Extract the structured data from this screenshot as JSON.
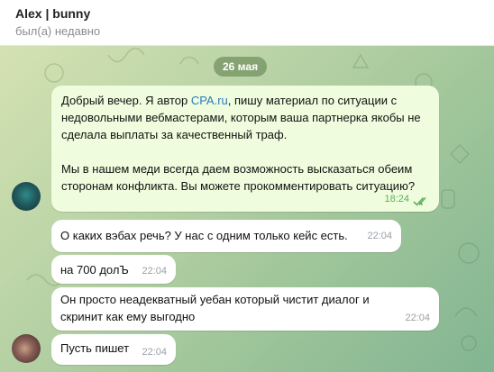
{
  "header": {
    "title": "Alex | bunny",
    "status": "был(а) недавно"
  },
  "chat": {
    "date_label": "26 мая",
    "outgoing": {
      "text_before_link": "Добрый вечер. Я автор ",
      "link": "CPA.ru",
      "text_after_link": ", пишу материал по ситуации с недовольными вебмастерами, которым ваша партнерка якобы не сделала выплаты за качественный траф.\n\nМы в нашем меди всегда даем возможность высказаться обеим сторонам конфликта. Вы можете прокомментировать ситуацию?",
      "time": "18:24",
      "status_icon": "double-check-icon"
    },
    "incoming": [
      {
        "text": "О каких вэбах речь? У нас с одним только кейс есть.",
        "time": "22:04"
      },
      {
        "text": "на 700 долЪ",
        "time": "22:04"
      },
      {
        "text": "Он просто неадекватный уебан который чистит диалог и скринит как ему выгодно",
        "time": "22:04"
      },
      {
        "text": "Пусть пишет",
        "time": "22:04"
      }
    ]
  },
  "colors": {
    "outgoing_bubble": "#effdde",
    "incoming_bubble": "#ffffff",
    "link": "#2a7ab8",
    "read_checks": "#5fae5a",
    "date_pill": "#6b8a58"
  }
}
